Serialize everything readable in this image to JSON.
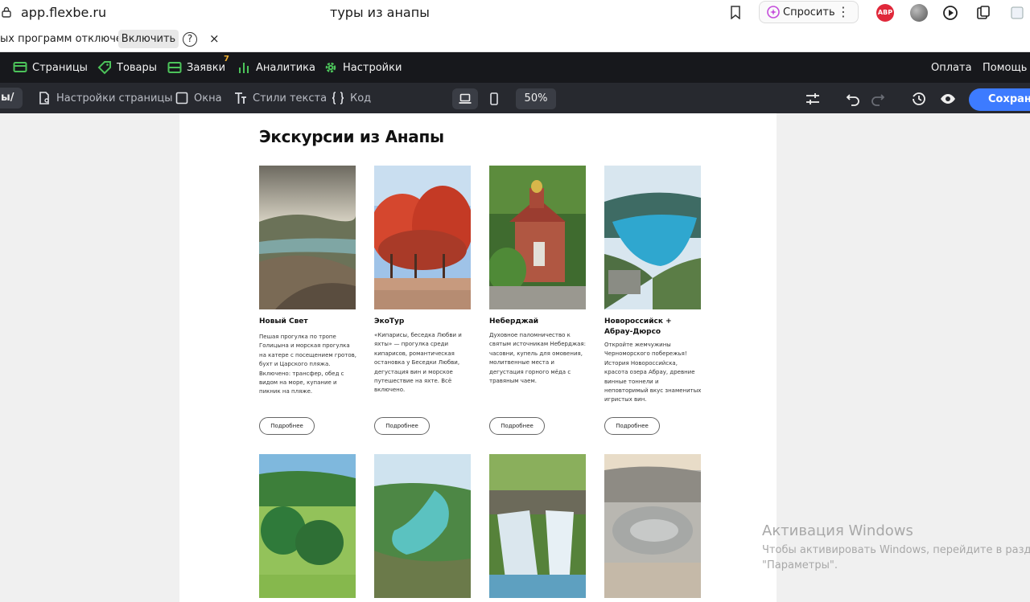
{
  "browser": {
    "url": "app.flexbe.ru",
    "tab_title": "туры из анапы",
    "ask_label": "Спросить",
    "abp_label": "ABP"
  },
  "infobar": {
    "message": "ых программ отключена",
    "enable_label": "Включить",
    "help_label": "?",
    "close_label": "×"
  },
  "appnav": {
    "items": [
      {
        "label": "Страницы",
        "icon": "screen-icon"
      },
      {
        "label": "Товары",
        "icon": "tag-icon"
      },
      {
        "label": "Заявки",
        "icon": "inbox-icon"
      },
      {
        "label": "Аналитика",
        "icon": "bar-chart-icon"
      },
      {
        "label": "Настройки",
        "icon": "gear-icon"
      }
    ],
    "requests_badge": "7",
    "pay_label": "Оплата",
    "help_label": "Помощь",
    "accent_color": "#4cc35a"
  },
  "toolbar": {
    "first_tab": "ы/",
    "items": [
      {
        "label": "Настройки страницы",
        "icon": "page-settings-icon"
      },
      {
        "label": "Окна",
        "icon": "window-icon"
      },
      {
        "label": "Стили текста",
        "icon": "text-style-icon"
      },
      {
        "label": "Код",
        "icon": "code-icon"
      }
    ],
    "zoom": "50%",
    "save_label": "Сохрани",
    "save_color": "#3d7bff"
  },
  "page": {
    "title": "Экскурсии из Анапы",
    "more_label": "Подробнее",
    "cards": [
      {
        "title": "Новый Свет",
        "desc": "Пешая прогулка по тропе Голицына и морская прогулка на катере с посещением гротов, бухт и Царского пляжа. Включено: трансфер, обед с видом на море, купание и пикник на пляже."
      },
      {
        "title": "ЭкоТур",
        "desc": "«Кипарисы, беседка Любви и яхты» — прогулка среди кипарисов, романтическая остановка у Беседки Любви, дегустация вин и морское путешествие на яхте. Всё включено."
      },
      {
        "title": "Неберджай",
        "desc": "Духовное паломничество к святым источникам Неберджая: часовни, купель для омовения, молитвенные места и дегустация горного мёда с травяным чаем."
      },
      {
        "title": "Новороссийск + Абрау-Дюрсо",
        "desc": "Откройте жемчужины Черноморского побережья! История Новороссийска, красота озера Абрау, древние винные тоннели и неповторимый вкус знаменитых игристых вин."
      }
    ]
  },
  "watermark": {
    "title": "Активация Windows",
    "line1": "Чтобы активировать Windows, перейдите в раздел",
    "line2": "\"Параметры\"."
  }
}
